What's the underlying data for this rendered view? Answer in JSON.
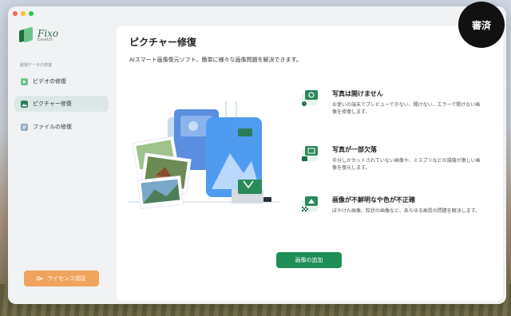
{
  "app": {
    "name": "Fixo",
    "vendor": "EaseUS"
  },
  "badge": {
    "text": "審済"
  },
  "sidebar": {
    "section_label": "破損データの修復",
    "items": [
      {
        "label": "ビデオの修復",
        "icon": "video-icon",
        "active": false
      },
      {
        "label": "ピクチャー修復",
        "icon": "picture-icon",
        "active": true
      },
      {
        "label": "ファイルの修復",
        "icon": "file-icon",
        "active": false
      }
    ],
    "license_button": "ライセンス認証"
  },
  "main": {
    "title": "ピクチャー修復",
    "subtitle": "AIスマート画像復元ソフト、簡単に様々な画像問題を解決できます。",
    "issues": [
      {
        "title": "写真は開けません",
        "description": "お使いの端末でプレビューできない、開けない、エラーで開けない画像を修復します。",
        "icon": "broken-image-icon"
      },
      {
        "title": "写真が一部欠落",
        "description": "半分しかカットされていない画像や、ミスプリなどの損傷が激しい画像を復元します。",
        "icon": "partial-image-icon"
      },
      {
        "title": "画像が不鮮明なや色が不正確",
        "description": "ぼやけた画像、粒状の画像など、あらゆる画質の問題を解決します。",
        "icon": "blurry-image-icon"
      }
    ],
    "add_button": "画像の追加"
  },
  "colors": {
    "accent_green": "#1e8e57",
    "license_orange": "#f0a35c",
    "active_nav_bg": "#dce8e6"
  }
}
